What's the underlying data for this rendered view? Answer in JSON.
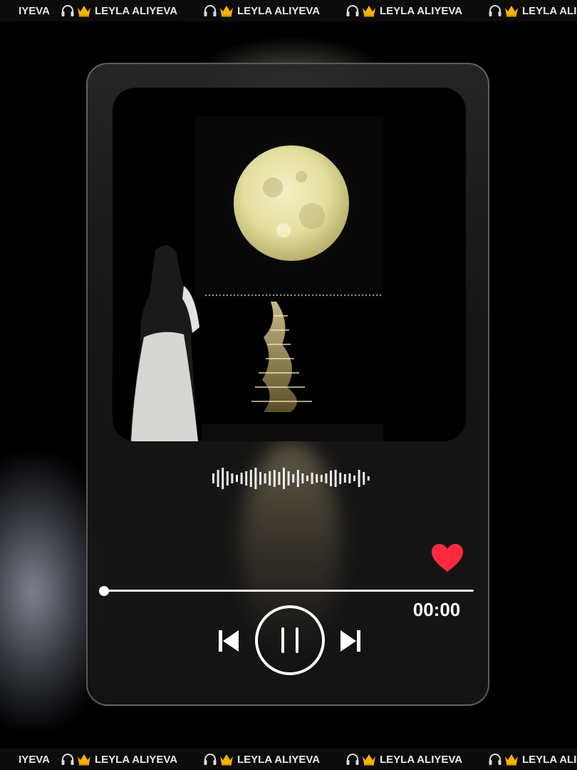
{
  "ticker": {
    "label": "LEYLA ALIYEVA",
    "partial_label": "IYEVA"
  },
  "player": {
    "time": "00:00",
    "progress": 0,
    "liked": true,
    "state": "playing",
    "colors": {
      "heart": "#ff2a3f",
      "accent": "#ffffff",
      "card": "#1a1a1a"
    },
    "icons": {
      "like": "heart-icon",
      "previous": "skip-previous-icon",
      "pause": "pause-icon",
      "next": "skip-next-icon",
      "waveform": "waveform-icon",
      "ticker_icons": [
        "headphones-icon",
        "crown-icon"
      ]
    }
  }
}
